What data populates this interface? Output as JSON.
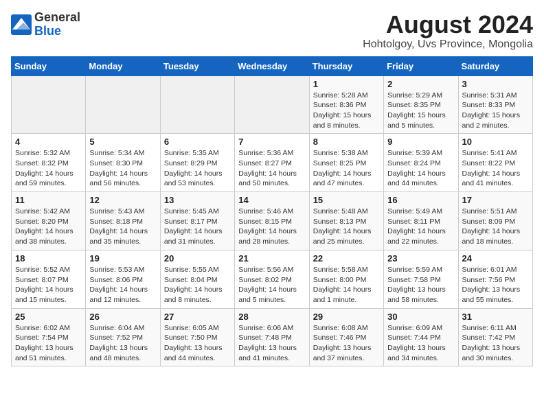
{
  "header": {
    "logo_general": "General",
    "logo_blue": "Blue",
    "main_title": "August 2024",
    "subtitle": "Hohtolgoy, Uvs Province, Mongolia"
  },
  "days_of_week": [
    "Sunday",
    "Monday",
    "Tuesday",
    "Wednesday",
    "Thursday",
    "Friday",
    "Saturday"
  ],
  "weeks": [
    [
      {
        "day": "",
        "info": ""
      },
      {
        "day": "",
        "info": ""
      },
      {
        "day": "",
        "info": ""
      },
      {
        "day": "",
        "info": ""
      },
      {
        "day": "1",
        "info": "Sunrise: 5:28 AM\nSunset: 8:36 PM\nDaylight: 15 hours\nand 8 minutes."
      },
      {
        "day": "2",
        "info": "Sunrise: 5:29 AM\nSunset: 8:35 PM\nDaylight: 15 hours\nand 5 minutes."
      },
      {
        "day": "3",
        "info": "Sunrise: 5:31 AM\nSunset: 8:33 PM\nDaylight: 15 hours\nand 2 minutes."
      }
    ],
    [
      {
        "day": "4",
        "info": "Sunrise: 5:32 AM\nSunset: 8:32 PM\nDaylight: 14 hours\nand 59 minutes."
      },
      {
        "day": "5",
        "info": "Sunrise: 5:34 AM\nSunset: 8:30 PM\nDaylight: 14 hours\nand 56 minutes."
      },
      {
        "day": "6",
        "info": "Sunrise: 5:35 AM\nSunset: 8:29 PM\nDaylight: 14 hours\nand 53 minutes."
      },
      {
        "day": "7",
        "info": "Sunrise: 5:36 AM\nSunset: 8:27 PM\nDaylight: 14 hours\nand 50 minutes."
      },
      {
        "day": "8",
        "info": "Sunrise: 5:38 AM\nSunset: 8:25 PM\nDaylight: 14 hours\nand 47 minutes."
      },
      {
        "day": "9",
        "info": "Sunrise: 5:39 AM\nSunset: 8:24 PM\nDaylight: 14 hours\nand 44 minutes."
      },
      {
        "day": "10",
        "info": "Sunrise: 5:41 AM\nSunset: 8:22 PM\nDaylight: 14 hours\nand 41 minutes."
      }
    ],
    [
      {
        "day": "11",
        "info": "Sunrise: 5:42 AM\nSunset: 8:20 PM\nDaylight: 14 hours\nand 38 minutes."
      },
      {
        "day": "12",
        "info": "Sunrise: 5:43 AM\nSunset: 8:18 PM\nDaylight: 14 hours\nand 35 minutes."
      },
      {
        "day": "13",
        "info": "Sunrise: 5:45 AM\nSunset: 8:17 PM\nDaylight: 14 hours\nand 31 minutes."
      },
      {
        "day": "14",
        "info": "Sunrise: 5:46 AM\nSunset: 8:15 PM\nDaylight: 14 hours\nand 28 minutes."
      },
      {
        "day": "15",
        "info": "Sunrise: 5:48 AM\nSunset: 8:13 PM\nDaylight: 14 hours\nand 25 minutes."
      },
      {
        "day": "16",
        "info": "Sunrise: 5:49 AM\nSunset: 8:11 PM\nDaylight: 14 hours\nand 22 minutes."
      },
      {
        "day": "17",
        "info": "Sunrise: 5:51 AM\nSunset: 8:09 PM\nDaylight: 14 hours\nand 18 minutes."
      }
    ],
    [
      {
        "day": "18",
        "info": "Sunrise: 5:52 AM\nSunset: 8:07 PM\nDaylight: 14 hours\nand 15 minutes."
      },
      {
        "day": "19",
        "info": "Sunrise: 5:53 AM\nSunset: 8:06 PM\nDaylight: 14 hours\nand 12 minutes."
      },
      {
        "day": "20",
        "info": "Sunrise: 5:55 AM\nSunset: 8:04 PM\nDaylight: 14 hours\nand 8 minutes."
      },
      {
        "day": "21",
        "info": "Sunrise: 5:56 AM\nSunset: 8:02 PM\nDaylight: 14 hours\nand 5 minutes."
      },
      {
        "day": "22",
        "info": "Sunrise: 5:58 AM\nSunset: 8:00 PM\nDaylight: 14 hours\nand 1 minute."
      },
      {
        "day": "23",
        "info": "Sunrise: 5:59 AM\nSunset: 7:58 PM\nDaylight: 13 hours\nand 58 minutes."
      },
      {
        "day": "24",
        "info": "Sunrise: 6:01 AM\nSunset: 7:56 PM\nDaylight: 13 hours\nand 55 minutes."
      }
    ],
    [
      {
        "day": "25",
        "info": "Sunrise: 6:02 AM\nSunset: 7:54 PM\nDaylight: 13 hours\nand 51 minutes."
      },
      {
        "day": "26",
        "info": "Sunrise: 6:04 AM\nSunset: 7:52 PM\nDaylight: 13 hours\nand 48 minutes."
      },
      {
        "day": "27",
        "info": "Sunrise: 6:05 AM\nSunset: 7:50 PM\nDaylight: 13 hours\nand 44 minutes."
      },
      {
        "day": "28",
        "info": "Sunrise: 6:06 AM\nSunset: 7:48 PM\nDaylight: 13 hours\nand 41 minutes."
      },
      {
        "day": "29",
        "info": "Sunrise: 6:08 AM\nSunset: 7:46 PM\nDaylight: 13 hours\nand 37 minutes."
      },
      {
        "day": "30",
        "info": "Sunrise: 6:09 AM\nSunset: 7:44 PM\nDaylight: 13 hours\nand 34 minutes."
      },
      {
        "day": "31",
        "info": "Sunrise: 6:11 AM\nSunset: 7:42 PM\nDaylight: 13 hours\nand 30 minutes."
      }
    ]
  ]
}
